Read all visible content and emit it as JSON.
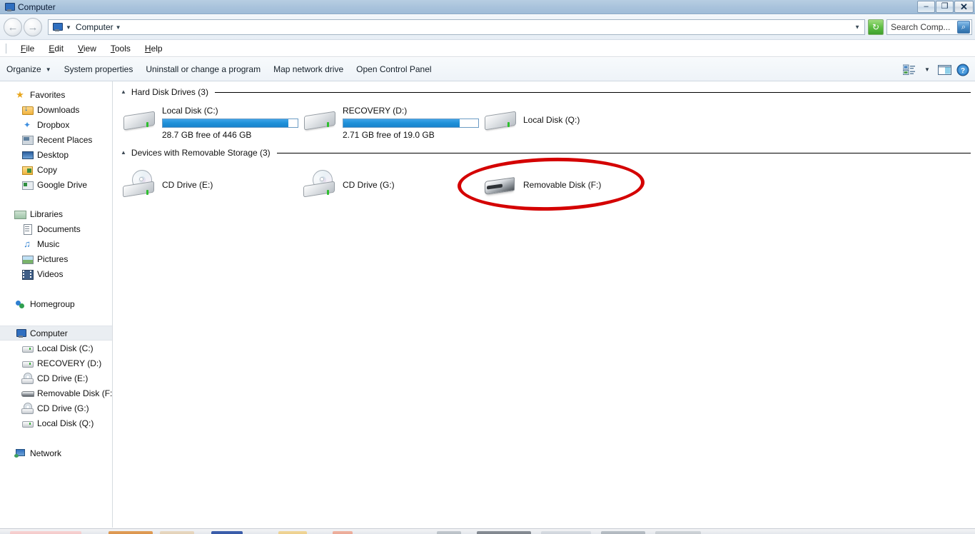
{
  "window": {
    "title": "Computer",
    "title_icon": "computer-icon",
    "buttons": {
      "minimize": "–",
      "maximize": "❐",
      "close": "✕"
    }
  },
  "addressbar": {
    "back_label": "←",
    "forward_label": "→",
    "icon": "computer-icon",
    "caret": "▼",
    "crumb": "Computer",
    "crumb_caret": "▼",
    "dropdown": "▼",
    "refresh_label": "↻",
    "search": {
      "placeholder": "Search Comp...",
      "icon": "magnifier-icon",
      "icon_glyph": "⌕"
    }
  },
  "menubar": {
    "items": [
      {
        "label": "File",
        "accesskey": "F"
      },
      {
        "label": "Edit",
        "accesskey": "E"
      },
      {
        "label": "View",
        "accesskey": "V"
      },
      {
        "label": "Tools",
        "accesskey": "T"
      },
      {
        "label": "Help",
        "accesskey": "H"
      }
    ]
  },
  "commandbar": {
    "items": [
      {
        "label": "Organize",
        "caret": "▼"
      },
      {
        "label": "System properties",
        "caret": ""
      },
      {
        "label": "Uninstall or change a program",
        "caret": ""
      },
      {
        "label": "Map network drive",
        "caret": ""
      },
      {
        "label": "Open Control Panel",
        "caret": ""
      }
    ],
    "right_icons": [
      {
        "name": "change-view-icon",
        "glyph": ""
      },
      {
        "name": "chevron-down-icon",
        "glyph": "▼"
      },
      {
        "name": "preview-pane-icon",
        "glyph": ""
      },
      {
        "name": "help-icon",
        "glyph": "?"
      }
    ]
  },
  "sidebar": {
    "items": [
      {
        "label": "Favorites",
        "icon": "star-icon",
        "level": "root",
        "selected": false
      },
      {
        "label": "Downloads",
        "icon": "downloads-icon",
        "level": "child",
        "selected": false
      },
      {
        "label": "Dropbox",
        "icon": "dropbox-icon",
        "level": "child",
        "selected": false
      },
      {
        "label": "Recent Places",
        "icon": "recent-places-icon",
        "level": "child",
        "selected": false
      },
      {
        "label": "Desktop",
        "icon": "desktop-icon",
        "level": "child",
        "selected": false
      },
      {
        "label": "Copy",
        "icon": "copy-folder-icon",
        "level": "child",
        "selected": false
      },
      {
        "label": "Google Drive",
        "icon": "google-drive-icon",
        "level": "child",
        "selected": false
      },
      {
        "label": "Libraries",
        "icon": "libraries-icon",
        "level": "root",
        "selected": false,
        "gap_before": true
      },
      {
        "label": "Documents",
        "icon": "documents-icon",
        "level": "child",
        "selected": false
      },
      {
        "label": "Music",
        "icon": "music-icon",
        "level": "child",
        "selected": false
      },
      {
        "label": "Pictures",
        "icon": "pictures-icon",
        "level": "child",
        "selected": false
      },
      {
        "label": "Videos",
        "icon": "videos-icon",
        "level": "child",
        "selected": false
      },
      {
        "label": "Homegroup",
        "icon": "homegroup-icon",
        "level": "root",
        "selected": false,
        "gap_before": true
      },
      {
        "label": "Computer",
        "icon": "computer-icon",
        "level": "root",
        "selected": true,
        "gap_before": true
      },
      {
        "label": "Local Disk (C:)",
        "icon": "hard-disk-icon",
        "level": "child",
        "selected": false
      },
      {
        "label": "RECOVERY (D:)",
        "icon": "hard-disk-icon",
        "level": "child",
        "selected": false
      },
      {
        "label": "CD Drive (E:)",
        "icon": "cd-drive-icon",
        "level": "child",
        "selected": false
      },
      {
        "label": "Removable Disk (F:)",
        "icon": "usb-drive-icon",
        "level": "child",
        "selected": false
      },
      {
        "label": "CD Drive (G:)",
        "icon": "cd-drive-icon",
        "level": "child",
        "selected": false
      },
      {
        "label": "Local Disk (Q:)",
        "icon": "hard-disk-icon",
        "level": "child",
        "selected": false
      },
      {
        "label": "Network",
        "icon": "network-icon",
        "level": "root",
        "selected": false,
        "gap_before": true
      }
    ]
  },
  "content": {
    "groups": [
      {
        "label": "Hard Disk Drives (3)",
        "collapse_glyph": "▲",
        "items": [
          {
            "name": "Local Disk (C:)",
            "icon": "hard-disk-icon",
            "has_bar": true,
            "bar_fill_percent": 93,
            "free_text": "28.7 GB free of 446 GB"
          },
          {
            "name": "RECOVERY (D:)",
            "icon": "hard-disk-icon",
            "has_bar": true,
            "bar_fill_percent": 86,
            "free_text": "2.71 GB free of 19.0 GB"
          },
          {
            "name": "Local Disk (Q:)",
            "icon": "hard-disk-icon",
            "has_bar": false,
            "bar_fill_percent": 0,
            "free_text": ""
          }
        ]
      },
      {
        "label": "Devices with Removable Storage (3)",
        "collapse_glyph": "▲",
        "items": [
          {
            "name": "CD Drive (E:)",
            "icon": "cd-drive-icon",
            "has_bar": false,
            "bar_fill_percent": 0,
            "free_text": ""
          },
          {
            "name": "CD Drive (G:)",
            "icon": "cd-drive-icon",
            "has_bar": false,
            "bar_fill_percent": 0,
            "free_text": ""
          },
          {
            "name": "Removable Disk (F:)",
            "icon": "usb-drive-icon",
            "has_bar": false,
            "bar_fill_percent": 0,
            "free_text": ""
          }
        ]
      }
    ]
  },
  "annotation": {
    "shape": "ellipse",
    "color": "#d40000",
    "targets": "Removable Disk (F:)"
  },
  "colors": {
    "titlebar": "#a9c3dc",
    "bar_fill": "#1e90d8",
    "bar_border": "#6c9cc4",
    "annotation_red": "#d40000",
    "selected_row": "#eaeef2"
  }
}
